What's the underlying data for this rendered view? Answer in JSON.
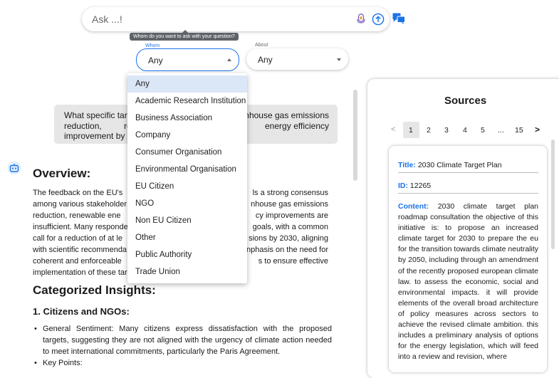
{
  "ask": {
    "placeholder": "Ask ...!"
  },
  "tooltip": "Whom do you want to ask with your question?",
  "whom": {
    "label": "Whom",
    "value": "Any"
  },
  "about": {
    "label": "About",
    "value": "Any"
  },
  "whom_options": [
    "Any",
    "Academic Research Institution",
    "Business Association",
    "Company",
    "Consumer Organisation",
    "Environmental Organisation",
    "EU Citizen",
    "NGO",
    "Non EU Citizen",
    "Other",
    "Public Authority",
    "Trade Union"
  ],
  "question": {
    "left": "What specific tar",
    "right_l1": "nhouse gas emissions",
    "l2a": "reduction,",
    "l2b": "rene",
    "l2c": "energy",
    "l2d": "efficiency",
    "l3": "improvement by 2"
  },
  "answer": {
    "overview_heading": "Overview:",
    "overview_lines": [
      [
        "The feedback on the EU's",
        "ls a strong consensus"
      ],
      [
        "among various stakeholder",
        "nhouse gas emissions"
      ],
      [
        "reduction, renewable ene",
        "cy improvements are"
      ],
      [
        "insufficient. Many responde",
        "goals, with a common"
      ],
      [
        "call for a reduction of at le",
        "sions by 2030, aligning"
      ],
      [
        "with scientific recommenda",
        "nphasis on the need for"
      ],
      [
        "coherent and enforceable",
        "s to ensure effective"
      ],
      [
        "implementation of these tar",
        ""
      ]
    ],
    "categorized_heading": "Categorized Insights:",
    "citizens_heading": "1. Citizens and NGOs:",
    "bullet1": "General Sentiment: Many citizens express dissatisfaction with the proposed targets, suggesting they are not aligned with the urgency of climate action needed to meet international commitments, particularly the Paris Agreement.",
    "bullet2": "Key Points:"
  },
  "sources": {
    "title": "Sources",
    "pages": [
      "1",
      "2",
      "3",
      "4",
      "5",
      "...",
      "15"
    ],
    "prev": "<",
    "next": ">",
    "card": {
      "title_key": "Title:",
      "title_value": "2030 Climate Target Plan",
      "id_key": "ID:",
      "id_value": "12265",
      "content_key": "Content:",
      "content_value": "2030 climate target plan roadmap consultation the objective of this initiative is: to propose an increased climate target for 2030 to prepare the eu for the transition towards climate neutrality by 2050, including through an amendment of the recently proposed european climate law. to assess the economic, social and environmental impacts. it will provide elements of the overall broad architecture of policy measures across sectors to achieve the revised climate ambition. this includes a preliminary analysis of options for the energy legislation, which will feed into a review and revision, where"
    }
  },
  "colors": {
    "accent": "#1a73e8",
    "selected_option": "#dbe6f7",
    "bubble": "#e6e6e6"
  },
  "icons": [
    "mic-icon",
    "send-icon",
    "chat-icon",
    "bot-icon"
  ]
}
